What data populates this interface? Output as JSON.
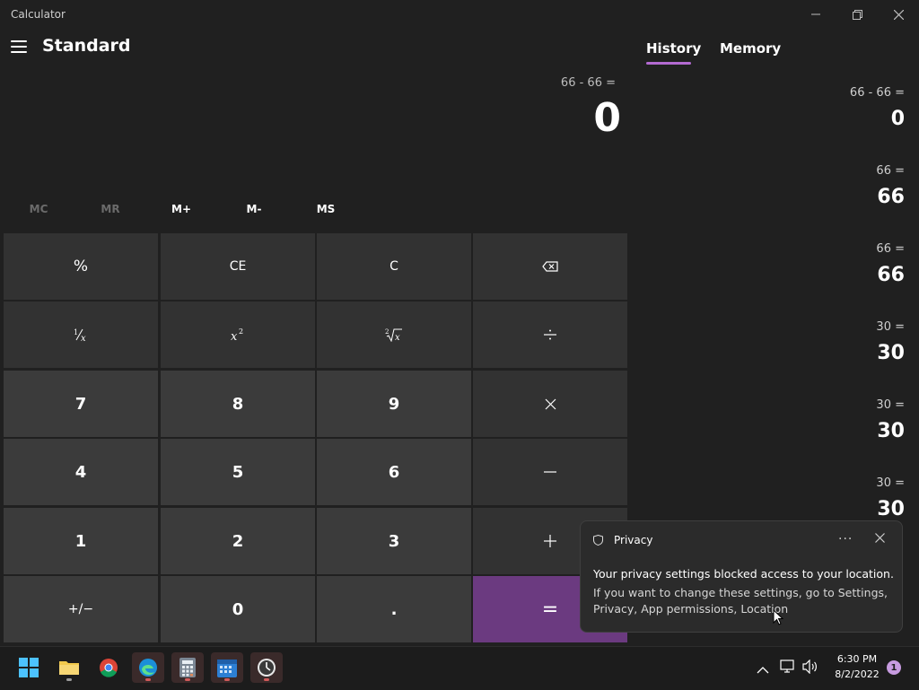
{
  "window": {
    "title": "Calculator"
  },
  "header": {
    "mode": "Standard"
  },
  "display": {
    "expression": "66 - 66 =",
    "result": "0"
  },
  "memory_row": [
    "MC",
    "MR",
    "M+",
    "M-",
    "MS"
  ],
  "keys": {
    "percent": "%",
    "ce": "CE",
    "c": "C",
    "seven": "7",
    "eight": "8",
    "nine": "9",
    "four": "4",
    "five": "5",
    "six": "6",
    "one": "1",
    "two": "2",
    "three": "3",
    "negate": "+/−",
    "zero": "0",
    "decimal": ".",
    "equals": "="
  },
  "tabs": {
    "history": "History",
    "memory": "Memory"
  },
  "history": [
    {
      "expression": "66   -   66 =",
      "result": "0"
    },
    {
      "expression": "66 =",
      "result": "66"
    },
    {
      "expression": "66 =",
      "result": "66"
    },
    {
      "expression": "30 =",
      "result": "30"
    },
    {
      "expression": "30 =",
      "result": "30"
    },
    {
      "expression": "30 =",
      "result": "30"
    }
  ],
  "toast": {
    "title": "Privacy",
    "line1": "Your privacy settings blocked access to your location.",
    "line2": "If you want to change these settings, go to Settings, Privacy, App permissions, Location"
  },
  "taskbar": {
    "time": "6:30 PM",
    "date": "8/2/2022",
    "notifications": "1",
    "apps": [
      "start-icon",
      "file-explorer-icon",
      "chrome-icon",
      "edge-icon",
      "calculator-icon",
      "calendar-icon",
      "clock-icon"
    ]
  },
  "colors": {
    "accent": "#6b3a80",
    "tab_underline": "#b36ad1"
  }
}
